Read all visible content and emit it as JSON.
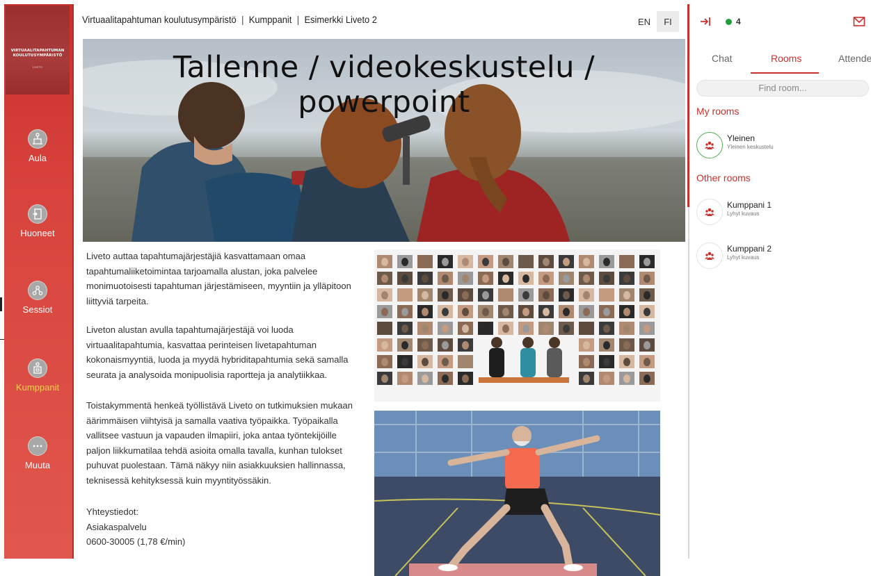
{
  "logo": {
    "line1": "VIRTUAALITAPAHTUMAN",
    "line2": "KOULUTUSYMPÄRISTÖ",
    "sub": "LIVETO"
  },
  "nav": [
    {
      "label": "Aula",
      "icon": "lobby-icon"
    },
    {
      "label": "Huoneet",
      "icon": "door-icon"
    },
    {
      "label": "Sessiot",
      "icon": "sessions-icon"
    },
    {
      "label": "Kumppanit",
      "icon": "partners-icon"
    },
    {
      "label": "Muuta",
      "icon": "more-icon"
    }
  ],
  "header": {
    "crumb1": "Virtuaalitapahtuman koulutusympäristö",
    "crumb2": "Kumppanit",
    "crumb3": "Esimerkki Liveto 2",
    "sep": "|",
    "lang_en": "EN",
    "lang_fi": "FI"
  },
  "hero": {
    "title": "Tallenne / videokeskustelu / powerpoint"
  },
  "content": {
    "p1": "Liveto auttaa tapahtumajärjestäjiä kasvattamaan omaa tapahtumaliiketoimintaa tarjoamalla alustan, joka palvelee monimuotoisesti tapahtuman järjestämiseen, myyntiin ja ylläpitoon liittyviä tarpeita.",
    "p2": "Liveton alustan avulla tapahtumajärjestäjä voi luoda virtuaalitapahtumia, kasvattaa perinteisen livetapahtuman kokonaismyyntiä, luoda ja myydä hybriditapahtumia sekä samalla seurata ja analysoida monipuolisia raportteja ja analytiikkaa.",
    "p3": "Toistakymmentä henkeä työllistävä Liveto on tutkimuksien mukaan äärimmäisen viihtyisä ja samalla vaativa työpaikka. Työpaikalla vallitsee vastuun ja vapauden ilmapiiri, joka antaa työntekijöille paljon liikkumatilaa tehdä asioita omalla tavalla, kunhan tulokset puhuvat puolestaan. Tämä näkyy niin asiakkuuksien hallinnassa, teknisessä kehityksessä kuin myyntityössäkin.",
    "contact_title": "Yhteystiedot:",
    "contact_line1": "Asiakaspalvelu",
    "contact_line2": "0600-30005 (1,78 €/min)"
  },
  "panel": {
    "online_count": "4",
    "tabs": {
      "chat": "Chat",
      "rooms": "Rooms",
      "attendees": "Attende"
    },
    "search_placeholder": "Find room...",
    "my_rooms_title": "My rooms",
    "other_rooms_title": "Other rooms",
    "my_rooms": [
      {
        "name": "Yleinen",
        "desc": "Yleinen keskustelu"
      }
    ],
    "other_rooms": [
      {
        "name": "Kumppani 1",
        "desc": "Lyhyt kuvaus"
      },
      {
        "name": "Kumppani 2",
        "desc": "Lyhyt kuvaus"
      }
    ]
  },
  "colors": {
    "brand_red": "#c9302c",
    "online_green": "#1f9d3a",
    "active_nav": "#f3d04d"
  }
}
